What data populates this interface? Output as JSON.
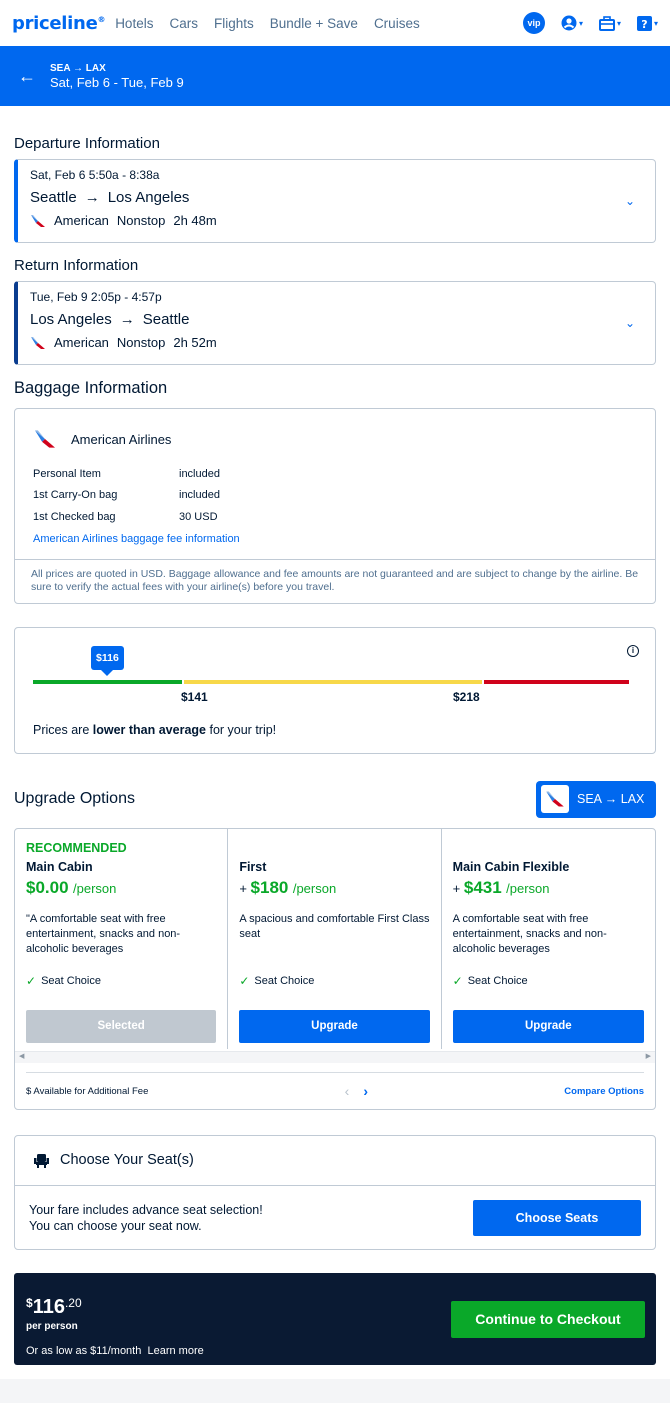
{
  "nav": {
    "logo": "priceline",
    "links": [
      "Hotels",
      "Cars",
      "Flights",
      "Bundle + Save",
      "Cruises"
    ],
    "vip": "vip"
  },
  "trip": {
    "route": "SEA → LAX",
    "dates": "Sat, Feb 6 - Tue, Feb 9"
  },
  "departure": {
    "heading": "Departure Information",
    "time": "Sat, Feb 6   5:50a - 8:38a",
    "from": "Seattle",
    "to": "Los Angeles",
    "airline": "American",
    "stops": "Nonstop",
    "duration": "2h 48m"
  },
  "return": {
    "heading": "Return Information",
    "time": "Tue, Feb 9   2:05p - 4:57p",
    "from": "Los Angeles",
    "to": "Seattle",
    "airline": "American",
    "stops": "Nonstop",
    "duration": "2h 52m"
  },
  "baggage": {
    "heading": "Baggage Information",
    "airline": "American Airlines",
    "rows": [
      {
        "item": "Personal Item",
        "value": "included"
      },
      {
        "item": "1st Carry-On bag",
        "value": "included"
      },
      {
        "item": "1st Checked bag",
        "value": "30 USD"
      }
    ],
    "link": "American Airlines baggage fee information",
    "note": "All prices are quoted in USD. Baggage allowance and fee amounts are not guaranteed and are subject to change by the airline. Be sure to verify the actual fees with your airline(s) before you travel."
  },
  "price_meter": {
    "current": "$116",
    "low_threshold": "$141",
    "high_threshold": "$218",
    "message_pre": "Prices are ",
    "message_bold": "lower than average",
    "message_post": " for your trip!",
    "colors": {
      "low": "#0aa829",
      "mid": "#f7d849",
      "high": "#d0021b"
    }
  },
  "upgrade": {
    "heading": "Upgrade Options",
    "route": "SEA → LAX",
    "options": [
      {
        "badge": "RECOMMENDED",
        "cabin": "Main Cabin",
        "plus": "",
        "price": "$0.00",
        "per": "/person",
        "desc": "\"A comfortable seat with free entertainment, snacks and non-alcoholic beverages",
        "feature": "Seat Choice",
        "button": "Selected"
      },
      {
        "badge": "",
        "cabin": "First",
        "plus": "+ ",
        "price": "$180",
        "per": "/person",
        "desc": "A spacious and comfortable First Class seat",
        "feature": "Seat Choice",
        "button": "Upgrade"
      },
      {
        "badge": "",
        "cabin": "Main Cabin Flexible",
        "plus": "+ ",
        "price": "$431",
        "per": "/person",
        "desc": "A comfortable seat with free entertainment, snacks and non-alcoholic beverages",
        "feature": "Seat Choice",
        "button": "Upgrade"
      }
    ],
    "fee_note": "$ Available for Additional Fee",
    "compare": "Compare Options"
  },
  "seats": {
    "heading": "Choose Your Seat(s)",
    "line1": "Your fare includes advance seat selection!",
    "line2": "You can choose your seat now.",
    "button": "Choose Seats"
  },
  "checkout": {
    "dollar": "$",
    "amount": "116",
    "cents": ".20",
    "per_person": "per person",
    "monthly": "Or as low as $11/month",
    "learn_more": "Learn more",
    "button": "Continue to Checkout"
  }
}
